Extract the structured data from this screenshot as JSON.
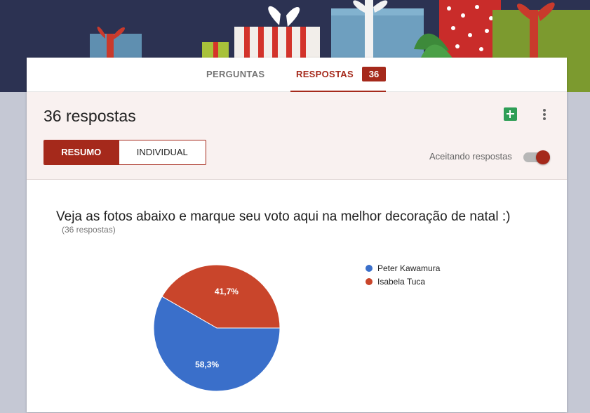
{
  "tabs": {
    "perguntas": "PERGUNTAS",
    "respostas": "RESPOSTAS",
    "respostas_count": "36"
  },
  "summary": {
    "title": "36 respostas",
    "segments": {
      "resumo": "RESUMO",
      "individual": "INDIVIDUAL"
    },
    "accepting_label": "Aceitando respostas",
    "accepting_on": true
  },
  "question": {
    "title": "Veja as fotos abaixo e marque seu voto aqui na melhor decoração de natal :)",
    "count": "(36 respostas)"
  },
  "colors": {
    "accent": "#a5291b",
    "banner": "#2c3252",
    "peter": "#3a6fca",
    "isabela": "#c9452b"
  },
  "chart_data": {
    "type": "pie",
    "series": [
      {
        "name": "Peter Kawamura",
        "value": 58.3,
        "label": "58,3%",
        "color": "#3a6fca"
      },
      {
        "name": "Isabela Tuca",
        "value": 41.7,
        "label": "41,7%",
        "color": "#c9452b"
      }
    ],
    "legend_position": "right"
  }
}
